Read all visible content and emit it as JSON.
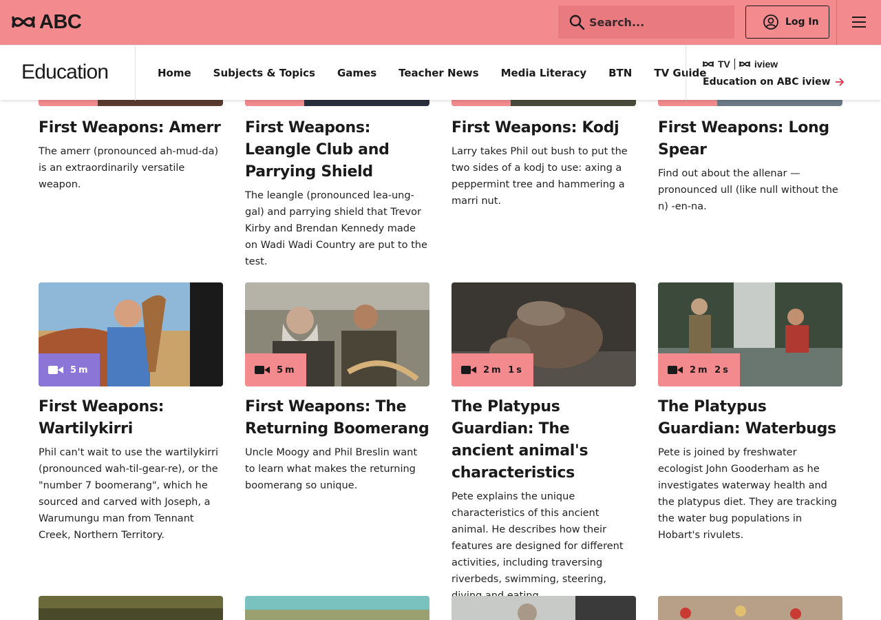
{
  "header": {
    "logo_text": "ABC",
    "search_placeholder": "Search...",
    "login_label": "Log In"
  },
  "nav": {
    "brand": "Education",
    "links": [
      "Home",
      "Subjects & Topics",
      "Games",
      "Teacher News",
      "Media Literacy",
      "BTN",
      "TV Guide"
    ],
    "abc_tv": "TV",
    "iview": "iview",
    "iview_link": "Education on ABC iview"
  },
  "cards_top": [
    {
      "title": "First Weapons: Amerr",
      "desc": "The amerr (pronounced ah-mud-da) is an extraordinarily versatile weapon."
    },
    {
      "title": "First Weapons: Leangle Club and Parrying Shield",
      "desc": "The leangle (pronounced lea-ung-gal) and parrying shield that Trevor Kirby and Brendan Kennedy made on Wadi Wadi Country are put to the test."
    },
    {
      "title": "First Weapons: Kodj",
      "desc": "Larry takes Phil out bush to put the two sides of a kodj to use: axing a peppermint tree and hammering a marri nut."
    },
    {
      "title": "First Weapons: Long Spear",
      "desc": "Find out about the allenar — pronounced ull (like null without the n) -en-na."
    }
  ],
  "cards_mid": [
    {
      "duration": "5m",
      "title": "First Weapons: Wartilykirri",
      "desc": "Phil can't wait to use the wartilykirri (pronounced wah-til-gear-re), or the \"number 7 boomerang\", which he sourced and carved with Joseph, a Warumungu man from Tennant Creek, Northern Territory."
    },
    {
      "duration": "5m",
      "title": "First Weapons: The Returning Boomerang",
      "desc": "Uncle Moogy and Phil Breslin want to learn what makes the returning boomerang so unique."
    },
    {
      "duration": "2m 1s",
      "title": "The Platypus Guardian: The ancient animal's characteristics",
      "desc": "Pete explains the unique characteristics of this ancient animal. He describes how their features are designed for different activities, including traversing riverbeds, swimming, steering, diving and eating."
    },
    {
      "duration": "2m 2s",
      "title": "The Platypus Guardian: Waterbugs",
      "desc": "Pete is joined by freshwater ecologist John Gooderham as he investigates waterway health and the platypus diet. They are tracking the water bug populations in Hobart's rivulets."
    }
  ],
  "colors": {
    "accent": "#f28a8e",
    "badge_active": "#8b75d6"
  }
}
